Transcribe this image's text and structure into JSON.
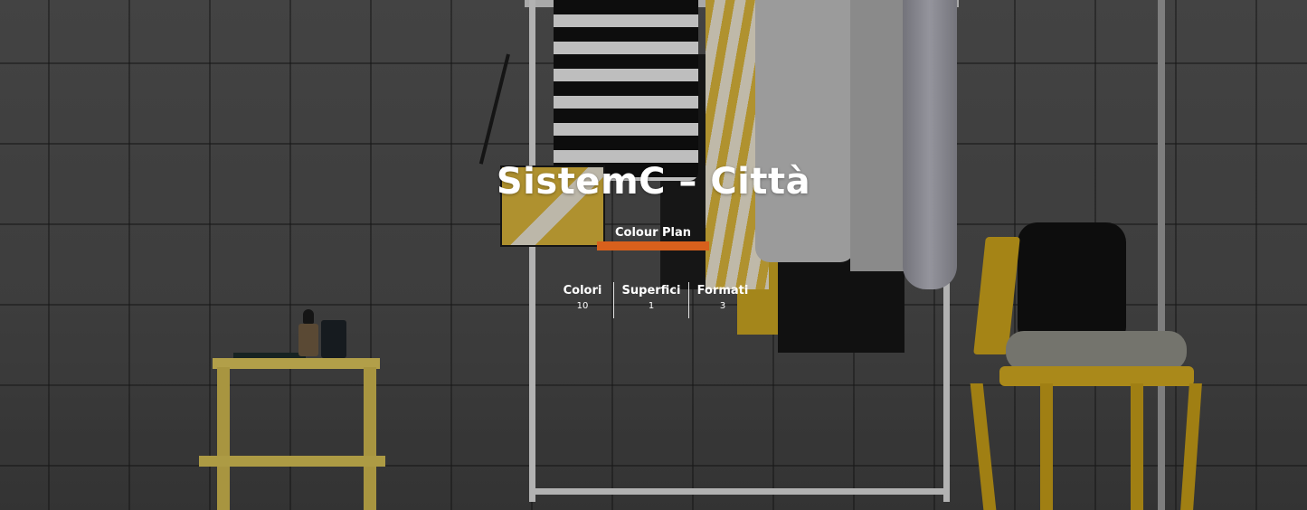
{
  "hero": {
    "title": "SistemC – Città",
    "tab": {
      "label": "Colour Plan",
      "accent_color": "#d8601c"
    },
    "stats": [
      {
        "label": "Colori",
        "value": "10"
      },
      {
        "label": "Superfici",
        "value": "1"
      },
      {
        "label": "Formati",
        "value": "3"
      }
    ]
  }
}
